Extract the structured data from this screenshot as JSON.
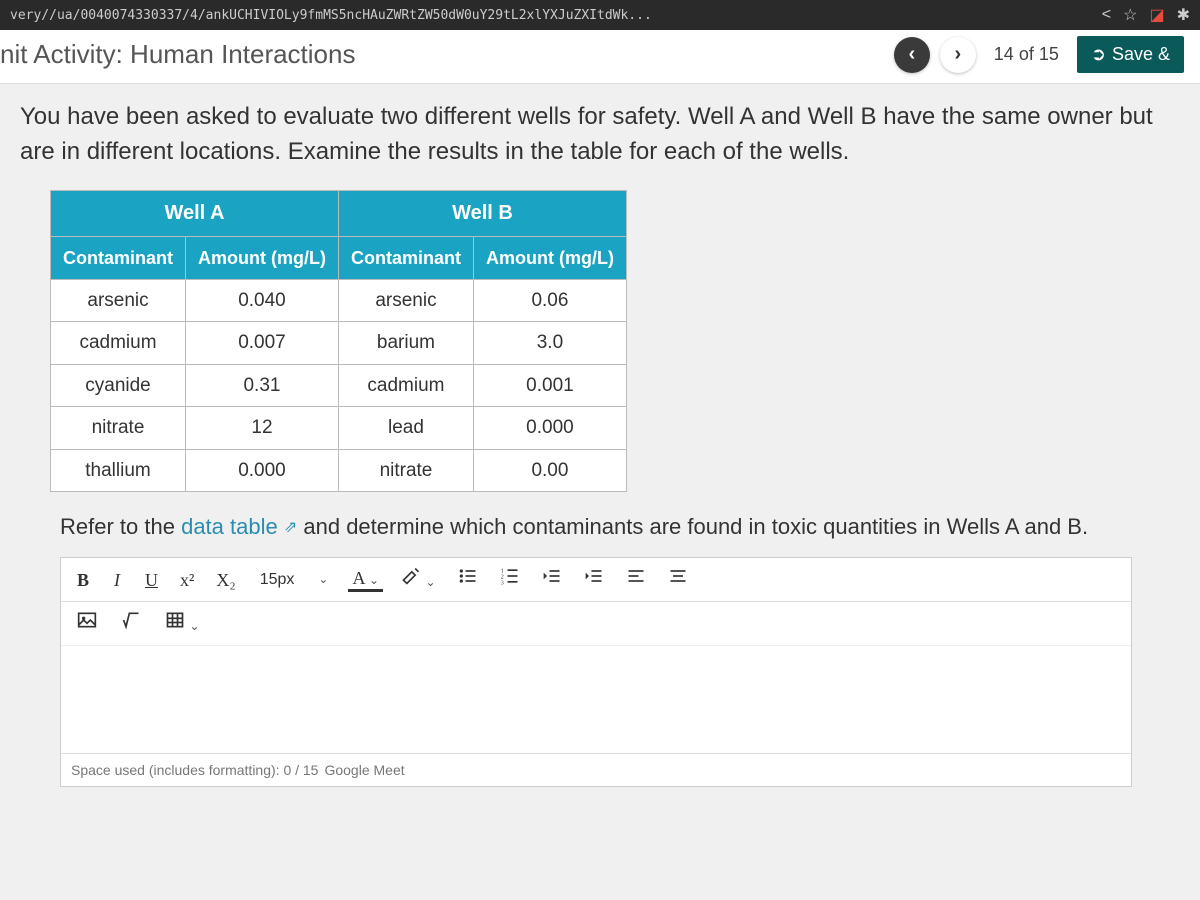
{
  "browser": {
    "url_fragment": "very//ua/0040074330337/4/ankUCHIVIOLy9fmMS5ncHAuZWRtZW50dW0uY29tL2xlYXJuZXItdWk...",
    "share_icon": "<",
    "star_icon": "☆",
    "bell_icon": "◪",
    "ext_icon": "✱"
  },
  "header": {
    "title": "nit Activity: Human Interactions",
    "prev": "‹",
    "next": "›",
    "counter": "14 of 15",
    "save": "Save &"
  },
  "prompt": "You have been asked to evaluate two different wells for safety. Well A and Well B have the same owner but are in different locations. Examine the results in the table for each of the wells.",
  "table": {
    "group_a": "Well A",
    "group_b": "Well B",
    "col_contaminant": "Contaminant",
    "col_amount": "Amount (mg/L)",
    "rows": [
      {
        "a_c": "arsenic",
        "a_v": "0.040",
        "b_c": "arsenic",
        "b_v": "0.06"
      },
      {
        "a_c": "cadmium",
        "a_v": "0.007",
        "b_c": "barium",
        "b_v": "3.0"
      },
      {
        "a_c": "cyanide",
        "a_v": "0.31",
        "b_c": "cadmium",
        "b_v": "0.001"
      },
      {
        "a_c": "nitrate",
        "a_v": "12",
        "b_c": "lead",
        "b_v": "0.000"
      },
      {
        "a_c": "thallium",
        "a_v": "0.000",
        "b_c": "nitrate",
        "b_v": "0.00"
      }
    ]
  },
  "question": {
    "prefix": "Refer to the ",
    "link": "data table",
    "suffix": " and determine which contaminants are found in toxic quantities in Wells A and B."
  },
  "toolbar": {
    "bold": "B",
    "italic": "I",
    "underline": "U",
    "sup": "x²",
    "sub": "X₂",
    "fontsize": "15px",
    "textcolor": "A",
    "image": "image",
    "formula": "√",
    "table": "⊞"
  },
  "footer": {
    "space": "Space used (includes formatting): 0 / 15",
    "meet": "Google Meet"
  }
}
